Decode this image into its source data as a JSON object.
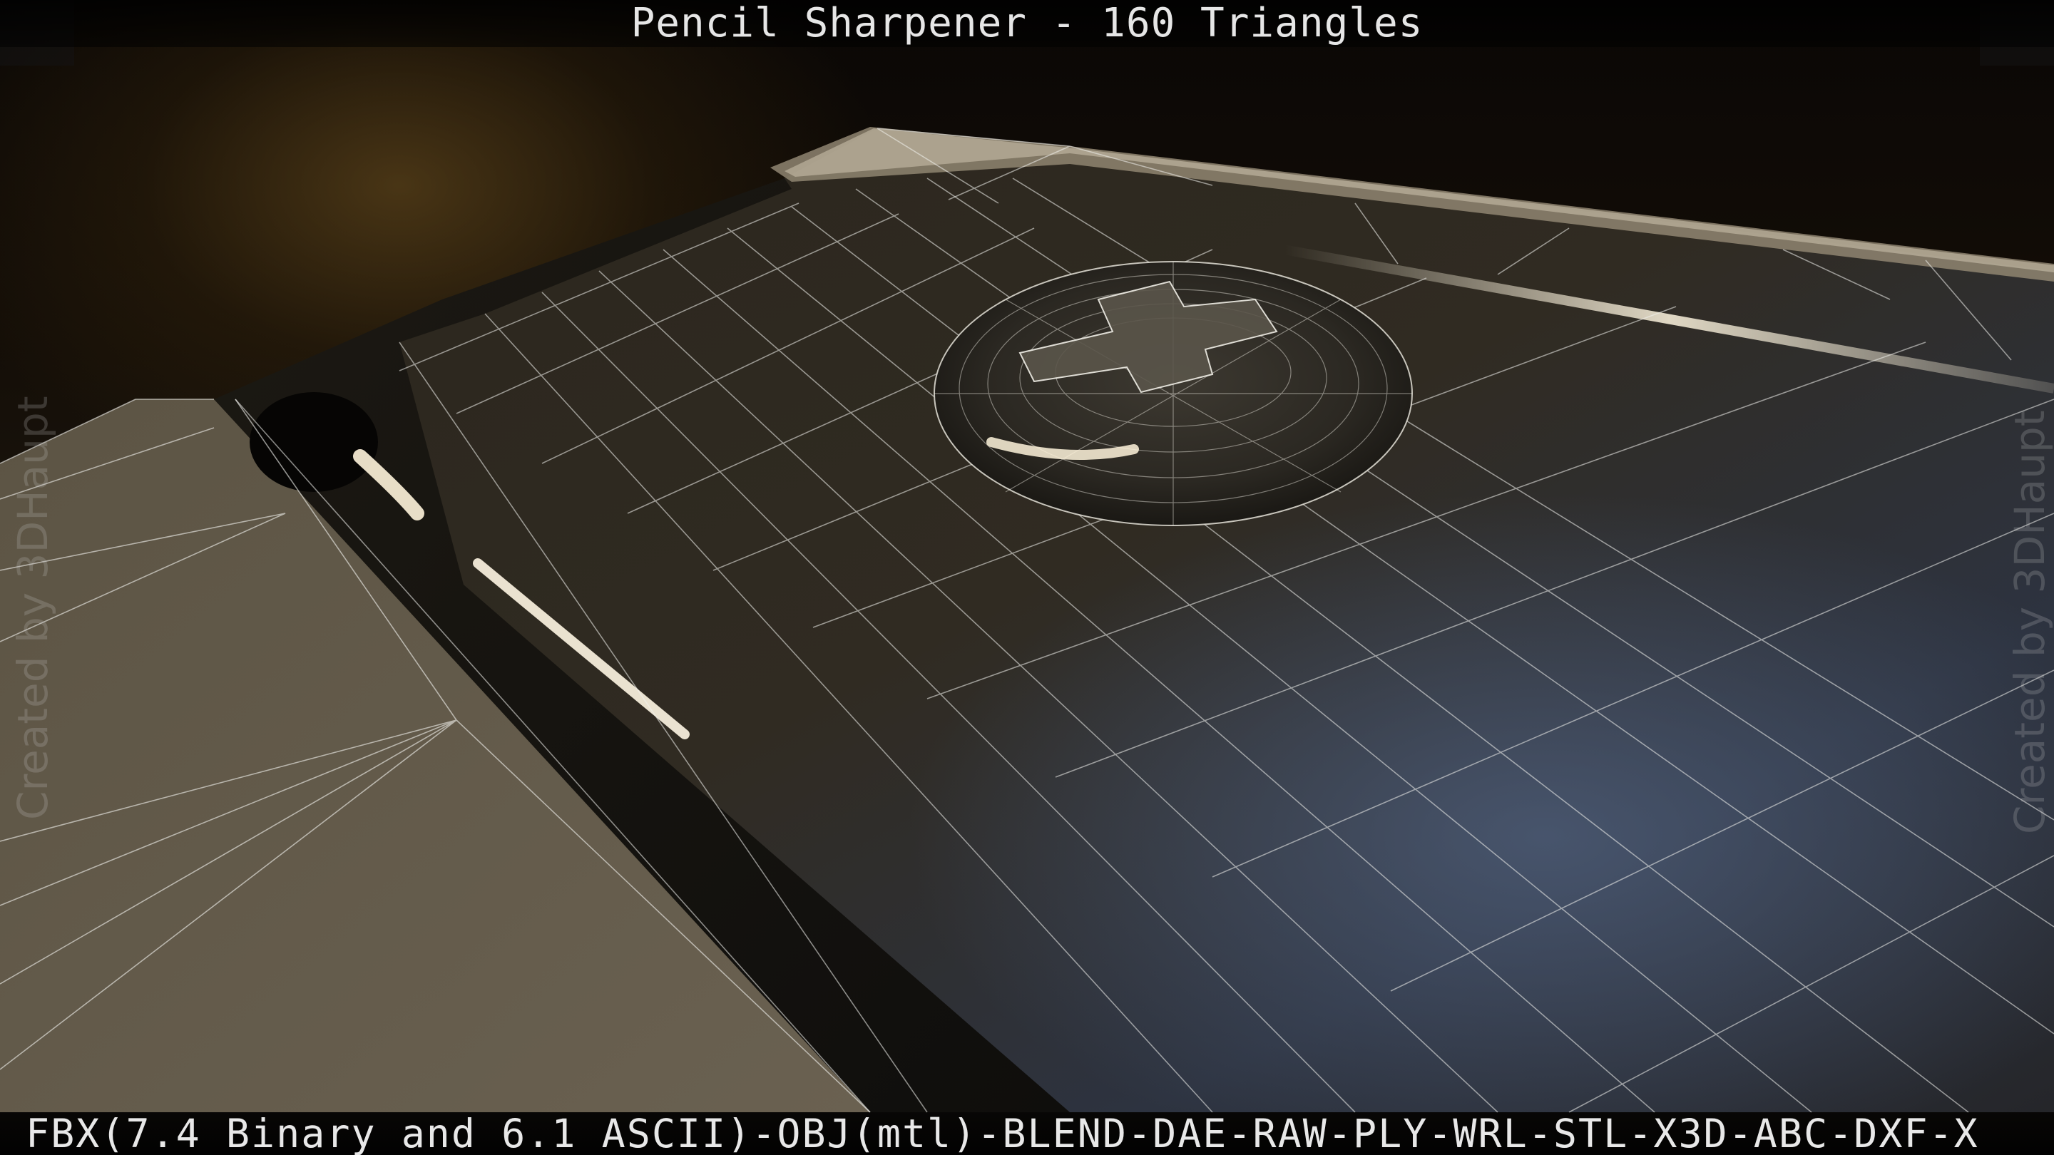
{
  "title": "Pencil Sharpener - 160 Triangles",
  "footer_formats": "FBX(7.4 Binary and 6.1 ASCII)-OBJ(mtl)-BLEND-DAE-RAW-PLY-WRL-STL-X3D-ABC-DXF-X",
  "watermark_left": "Created by 3DHaupt",
  "watermark_right": "Created by 3DHaupt",
  "colors": {
    "surface": "#3a3428",
    "wireframe": "#f2f2ee",
    "highlight": "#fff3d8",
    "background_glow": "#785822"
  }
}
